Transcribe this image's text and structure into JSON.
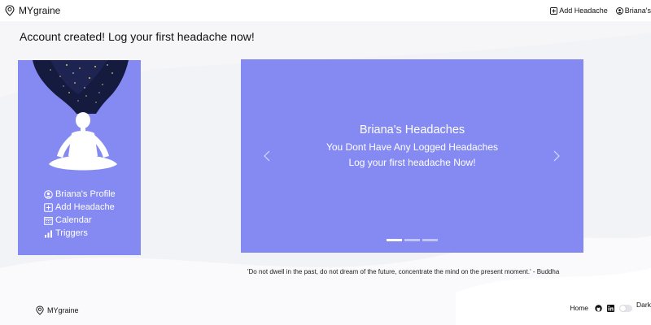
{
  "navbar": {
    "brand": "MYgraine",
    "add_headache": "Add Headache",
    "profile": "Briana's",
    "icons": {
      "brand": "brain-pin-icon",
      "add": "plus-square-icon",
      "profile": "user-circle-icon"
    }
  },
  "banner": "Account created! Log your first headache now!",
  "sidebar": {
    "art": "meditation-illustration",
    "items": [
      {
        "label": "Briana's Profile",
        "icon": "user-circle-icon"
      },
      {
        "label": "Add Headache",
        "icon": "plus-square-icon"
      },
      {
        "label": "Calendar",
        "icon": "calendar-icon"
      },
      {
        "label": "Triggers",
        "icon": "bar-chart-icon"
      }
    ]
  },
  "carousel": {
    "title": "Briana's Headaches",
    "line1": "You Dont Have Any Logged Headaches",
    "line2": "Log your first headache Now!",
    "slide_count": 3,
    "active_slide": 1
  },
  "quote": "'Do not dwell in the past, do not dream of the future, concentrate the mind on the present moment.' - Buddha",
  "footer": {
    "brand": "MYgraine",
    "home": "Home",
    "dark": "Dark",
    "icons": [
      "github-icon",
      "linkedin-icon"
    ],
    "dark_mode_on": false
  },
  "colors": {
    "accent": "#858af2",
    "background": "#f2f3f6",
    "text": "#111111"
  }
}
